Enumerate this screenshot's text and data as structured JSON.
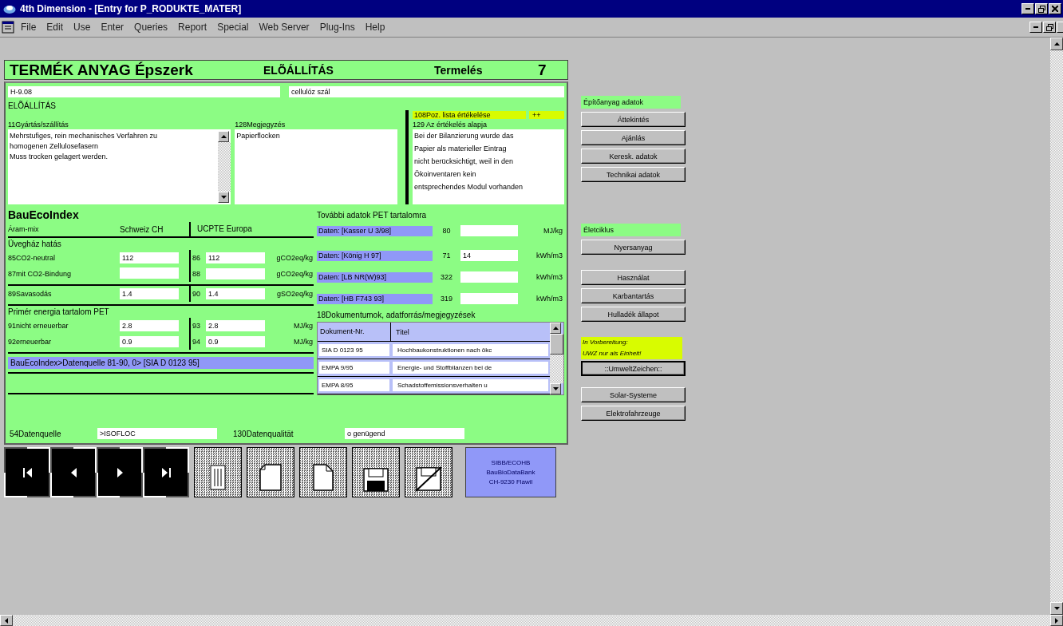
{
  "window": {
    "title": "4th Dimension - [Entry for P_RODUKTE_MATER]"
  },
  "menu": [
    "File",
    "Edit",
    "Use",
    "Enter",
    "Queries",
    "Report",
    "Special",
    "Web Server",
    "Plug-Ins",
    "Help"
  ],
  "form": {
    "header": {
      "title": "TERMÉK ANYAG Épszerk",
      "section": "ELÕÁLLÍTÁS",
      "category": "Termelés",
      "number": "7"
    },
    "code": "H-9.08",
    "name": "cellulóz szál",
    "section_label": "ELÕÁLLÍTÁS",
    "production": {
      "label": "11Gyártás/szállítás",
      "lines": [
        "Mehrstufiges, rein mechanisches Verfahren zu",
        "homogenen Zellulosefasern",
        "Muss trocken gelagert werden."
      ]
    },
    "remark": {
      "label": "128Megjegyzés",
      "lines": [
        "Papierflocken"
      ]
    },
    "rating": {
      "label": "108Poz. lista értékelése",
      "value": "++"
    },
    "basis": {
      "label": "129 Az értékelés alapja",
      "lines": [
        "Bei der Bilanzierung wurde das",
        "Papier als materieller Eintrag",
        "nicht berücksichtigt, weil in den",
        "Ökoinventaren kein",
        "entsprechendes Modul vorhanden"
      ]
    },
    "bauecoindex": {
      "title": "BauEcoIndex",
      "mix_label": "Áram-mix",
      "column_1": "Schweiz CH",
      "column_2": "UCPTE Europa",
      "groups": [
        {
          "title": "Üvegház hatás",
          "rows": [
            {
              "label": "85CO2-neutral",
              "value_1": "112",
              "number_2": "86",
              "value_2": "112",
              "unit": "gCO2eq/kg"
            },
            {
              "label": "87mit CO2-Bindung",
              "number_2": "88",
              "unit": "gCO2eq/kg"
            }
          ]
        },
        {
          "rows": [
            {
              "label": "89Savasodás",
              "value_1": "1.4",
              "number_2": "90",
              "value_2": "1.4",
              "unit": "gSO2eq/kg"
            }
          ]
        },
        {
          "title": "Primér energia tartalom PET",
          "rows": [
            {
              "label": "91nicht erneuerbar",
              "value_1": "2.8",
              "number_2": "93",
              "value_2": "2.8",
              "unit": "MJ/kg"
            },
            {
              "label": "92erneuerbar",
              "value_1": "0.9",
              "number_2": "94",
              "value_2": "0.9",
              "unit": "MJ/kg"
            }
          ]
        }
      ],
      "source": "BauEcoIndex>Datenquelle 81-90, 0> [SIA D 0123 95]"
    },
    "pet": {
      "title": "További adatok PET tartalomra",
      "rows": [
        {
          "source": "Daten: [Kasser U 3/98]",
          "number": "80",
          "unit": "MJ/kg"
        },
        {
          "source": "Daten: [König H 97]",
          "number": "71",
          "value": "14",
          "unit": "kWh/m3"
        },
        {
          "source": "Daten: [LB NR(W)93]",
          "number": "322",
          "unit": "kWh/m3"
        },
        {
          "source": "Daten: [HB F743 93]",
          "number": "319",
          "unit": "kWh/m3"
        }
      ]
    },
    "documents": {
      "title": "18Dokumentumok, adatforrás/megjegyzések",
      "columns": [
        "Dokument-Nr.",
        "Titel"
      ],
      "rows": [
        [
          "SIA D 0123 95",
          "Hochbaukonstruktionen nach ökc"
        ],
        [
          "EMPA 9/95",
          "Energie- und Stoffbilanzen bei de"
        ],
        [
          "EMPA 8/95",
          "Schadstoffemissionsverhalten u"
        ]
      ]
    },
    "data_source": {
      "label": "54Datenquelle",
      "value": ">ISOFLOC"
    },
    "data_quality": {
      "label": "130Datenqualität",
      "value": "o genügend"
    },
    "info_box": [
      "SIBB/ECOHB",
      "BauBioDataBank",
      "CH-9230 Flawil"
    ]
  },
  "side": {
    "groups": [
      [
        {
          "kind": "label",
          "text": "Építőanyag adatok"
        },
        {
          "kind": "button",
          "text": "Áttekintés"
        },
        {
          "kind": "button",
          "text": "Ajánlás"
        },
        {
          "kind": "button",
          "text": "Keresk. adatok"
        },
        {
          "kind": "button",
          "text": "Technikai adatok"
        }
      ],
      [
        {
          "kind": "label",
          "text": "Életciklus"
        },
        {
          "kind": "button",
          "text": "Nyersanyag"
        }
      ],
      [
        {
          "kind": "button",
          "text": "Használat"
        },
        {
          "kind": "button",
          "text": "Karbantartás"
        },
        {
          "kind": "button",
          "text": "Hulladék állapot"
        }
      ],
      [
        {
          "kind": "note",
          "text": "In Vorbereitung:"
        },
        {
          "kind": "note",
          "text": "UWZ nur als Einheit!"
        },
        {
          "kind": "button",
          "text": "::UmweltZeichen::"
        }
      ],
      [
        {
          "kind": "button",
          "text": "Solar-Systeme"
        },
        {
          "kind": "button",
          "text": "Elektrofahrzeuge"
        }
      ]
    ]
  }
}
